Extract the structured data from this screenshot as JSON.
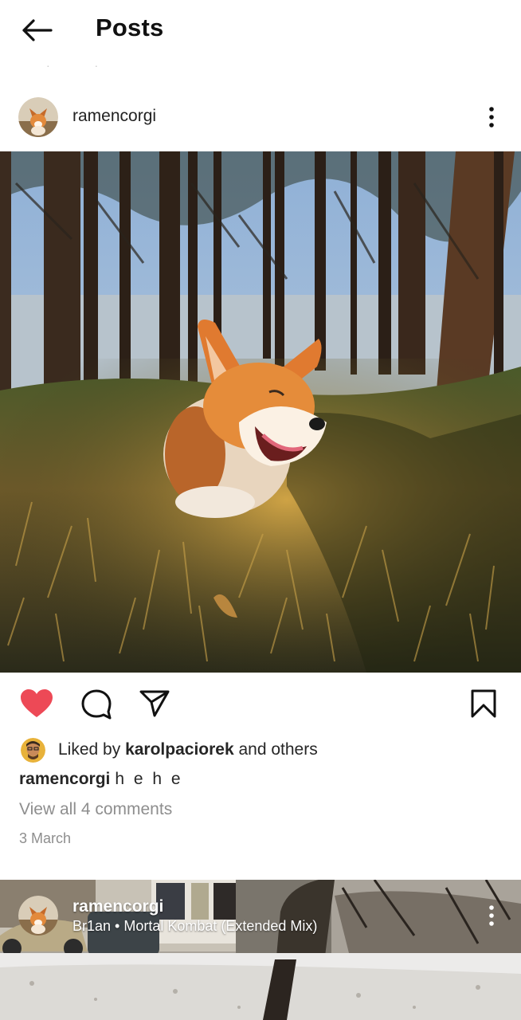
{
  "header": {
    "title": "Posts",
    "back_icon": "arrow-left-icon"
  },
  "post": {
    "username": "ramencorgi",
    "more_icon": "more-vertical-icon",
    "image_alt": "corgi-in-forest-photo",
    "actions": {
      "like_icon": "heart-filled-icon",
      "comment_icon": "comment-icon",
      "share_icon": "send-icon",
      "save_icon": "bookmark-icon"
    },
    "colors": {
      "like": "#ed4956"
    },
    "liked_by_prefix": "Liked by",
    "liked_by_user": "karolpaciorek",
    "liked_by_suffix": "and others",
    "caption_user": "ramencorgi",
    "caption_text": "hehe",
    "caption_display": "h e h e",
    "view_comments": "View all 4 comments",
    "date": "3 March"
  },
  "next_post": {
    "username": "ramencorgi",
    "audio": "Br1an • Mortal Kombat (Extended Mix)"
  }
}
